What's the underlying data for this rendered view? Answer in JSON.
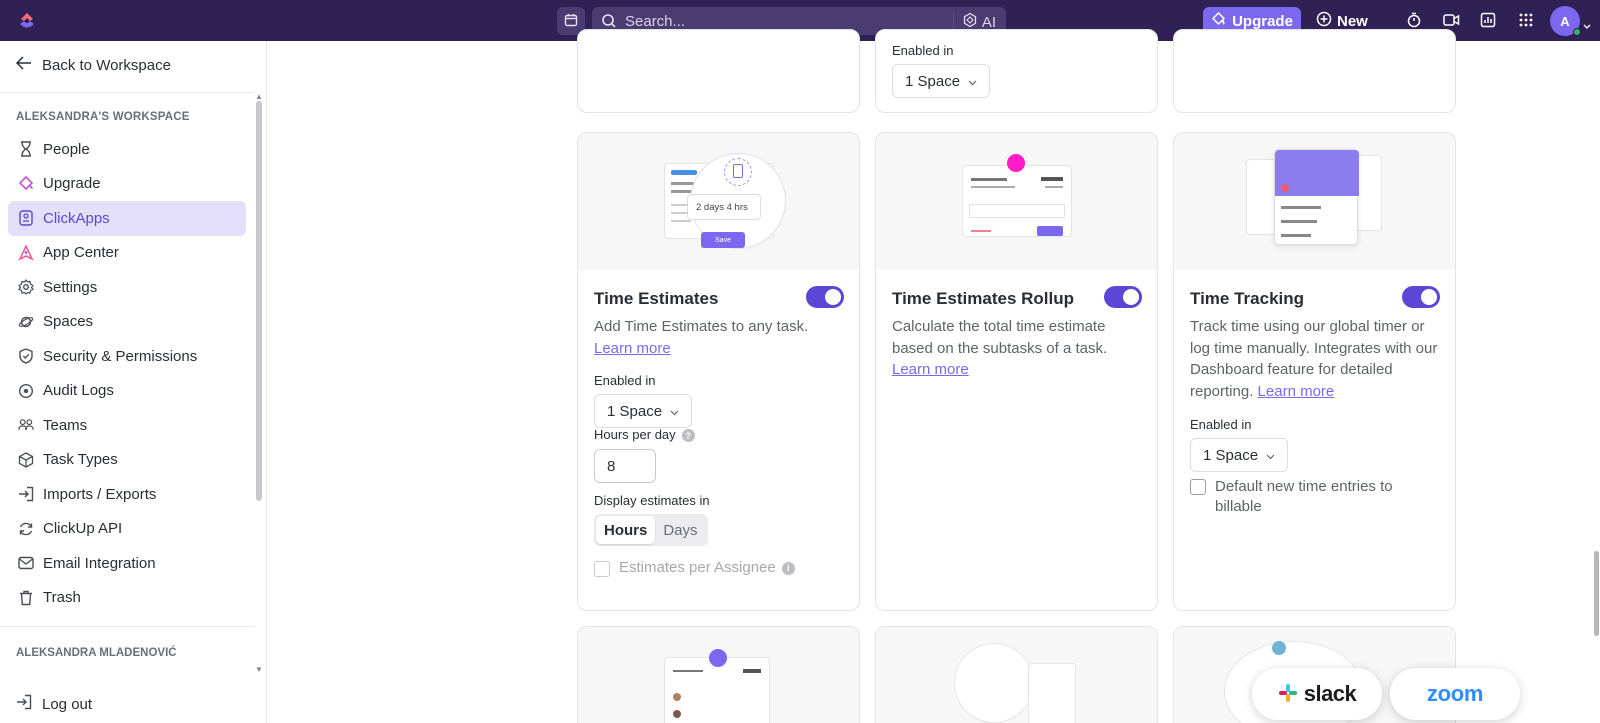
{
  "topbar": {
    "search_placeholder": "Search...",
    "ai_label": "AI",
    "upgrade_label": "Upgrade",
    "new_label": "New",
    "avatar_initial": "A"
  },
  "sidebar": {
    "back_label": "Back to Workspace",
    "workspace_title": "ALEKSANDRA'S WORKSPACE",
    "items": [
      {
        "label": "People",
        "icon": "hourglass-icon"
      },
      {
        "label": "Upgrade",
        "icon": "upgrade-icon"
      },
      {
        "label": "ClickApps",
        "icon": "clickapps-icon",
        "active": true
      },
      {
        "label": "App Center",
        "icon": "app-center-icon"
      },
      {
        "label": "Settings",
        "icon": "gear-icon"
      },
      {
        "label": "Spaces",
        "icon": "planet-icon"
      },
      {
        "label": "Security & Permissions",
        "icon": "shield-icon"
      },
      {
        "label": "Audit Logs",
        "icon": "audit-icon"
      },
      {
        "label": "Teams",
        "icon": "team-icon"
      },
      {
        "label": "Task Types",
        "icon": "cube-icon"
      },
      {
        "label": "Imports / Exports",
        "icon": "import-icon"
      },
      {
        "label": "ClickUp API",
        "icon": "sync-icon"
      },
      {
        "label": "Email Integration",
        "icon": "mail-icon"
      },
      {
        "label": "Trash",
        "icon": "trash-icon"
      }
    ],
    "user_title": "ALEKSANDRA MLADENOVIĆ",
    "logout_label": "Log out"
  },
  "top_cards": {
    "middle": {
      "enabled_label": "Enabled in",
      "space_value": "1 Space"
    }
  },
  "cards": {
    "time_estimates": {
      "title": "Time Estimates",
      "enabled": true,
      "desc": "Add Time Estimates to any task.",
      "learn_more": "Learn more",
      "enabled_label": "Enabled in",
      "space_value": "1 Space",
      "hours_label": "Hours per day",
      "hours_value": "8",
      "display_label": "Display estimates in",
      "display_options": [
        "Hours",
        "Days"
      ],
      "display_selected": "Hours",
      "estimates_per_assignee": "Estimates per Assignee",
      "hero_text": "2 days 4 hrs",
      "hero_save": "Save"
    },
    "time_estimates_rollup": {
      "title": "Time Estimates Rollup",
      "enabled": true,
      "desc": "Calculate the total time estimate based on the subtasks of a task.",
      "learn_more": "Learn more"
    },
    "time_tracking": {
      "title": "Time Tracking",
      "enabled": true,
      "desc": "Track time using our global timer or log time manually. Integrates with our Dashboard feature for detailed reporting.",
      "learn_more": "Learn more",
      "enabled_label": "Enabled in",
      "space_value": "1 Space",
      "billable_label": "Default new time entries to billable"
    }
  },
  "integrations": {
    "slack": "slack",
    "zoom": "zoom"
  },
  "colors": {
    "topbar": "#2f2154",
    "accent": "#7b68ee",
    "toggle_on": "#5b47d6"
  }
}
